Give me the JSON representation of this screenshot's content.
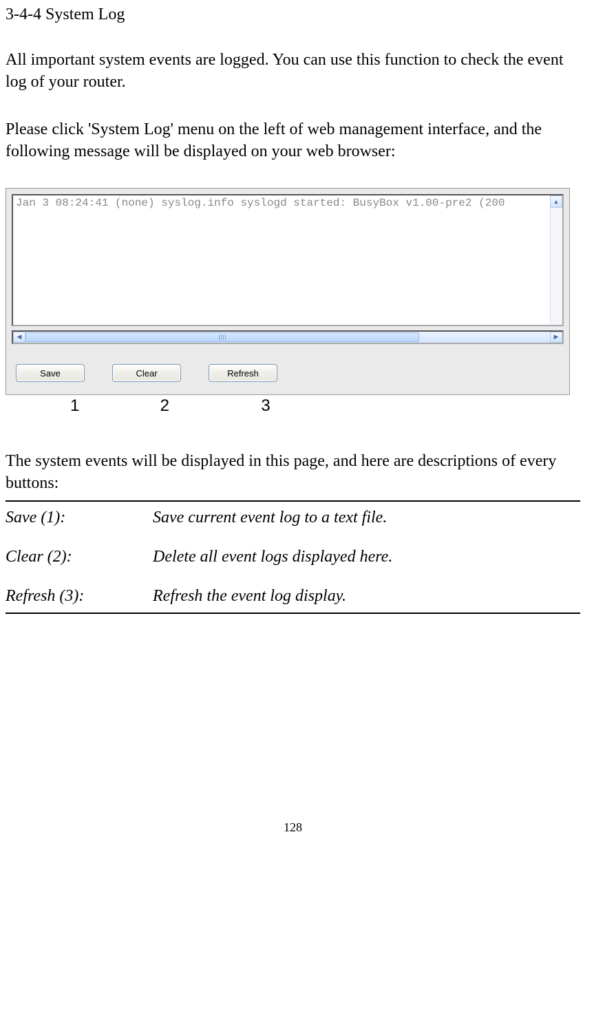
{
  "heading": "3-4-4 System Log",
  "para1": "All important system events are logged. You can use this function to check the event log of your router.",
  "para2": "Please click 'System Log' menu on the left of web management interface, and the following message will be displayed on your web browser:",
  "log_line": "Jan  3 08:24:41 (none) syslog.info syslogd started: BusyBox v1.00-pre2 (200",
  "buttons": {
    "save": "Save",
    "clear": "Clear",
    "refresh": "Refresh"
  },
  "nums": {
    "n1": "1",
    "n2": "2",
    "n3": "3"
  },
  "para3": "The system events will be displayed in this page, and here are descriptions of every buttons:",
  "desc": {
    "save_label": "Save (1):",
    "save_text": "Save current event log to a text file.",
    "clear_label": "Clear (2):",
    "clear_text": "Delete all event logs displayed here.",
    "refresh_label": "Refresh (3):",
    "refresh_text": "Refresh the event log display."
  },
  "page_number": "128"
}
